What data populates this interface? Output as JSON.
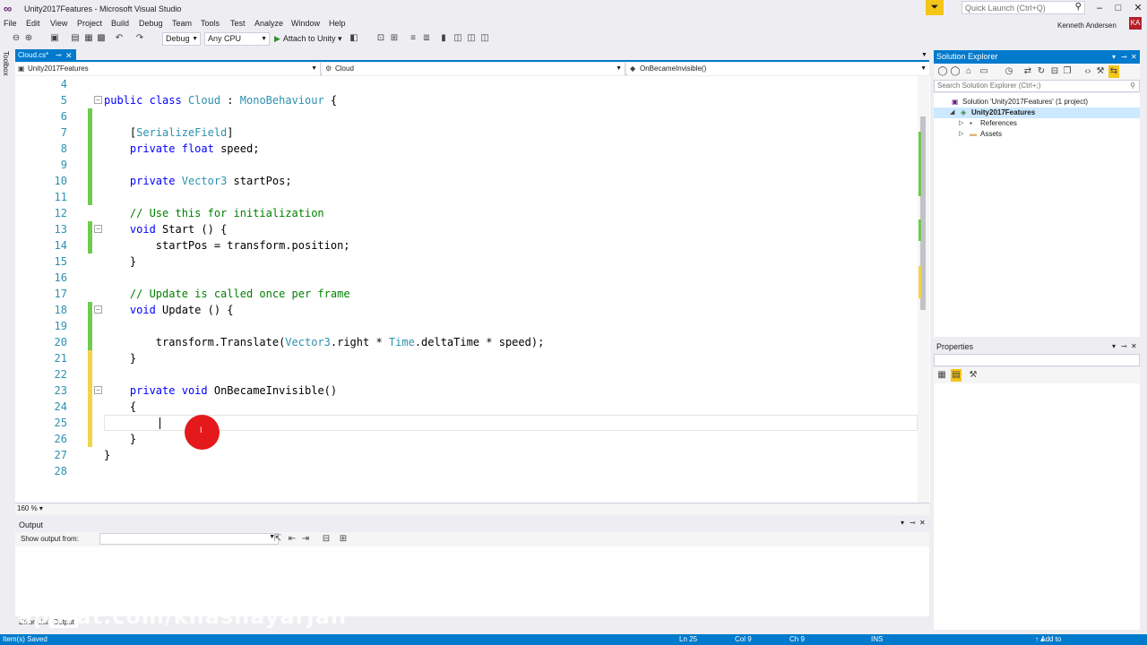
{
  "window": {
    "title": "Unity2017Features - Microsoft Visual Studio",
    "quick_launch_placeholder": "Quick Launch (Ctrl+Q)",
    "account": "Kenneth Andersen",
    "avatar_initials": "KA"
  },
  "menu": [
    "File",
    "Edit",
    "View",
    "Project",
    "Build",
    "Debug",
    "Team",
    "Tools",
    "Test",
    "Analyze",
    "Window",
    "Help"
  ],
  "toolbar": {
    "config": "Debug",
    "platform": "Any CPU",
    "attach_label": "Attach to Unity"
  },
  "toolbox_label": "Toolbox",
  "editor": {
    "tab_label": "Cloud.cs*",
    "nav_project": "Unity2017Features",
    "nav_class": "Cloud",
    "nav_member": "OnBecameInvisible()",
    "zoom": "160 %",
    "lines": [
      {
        "num": "4",
        "change": "none",
        "fold": false,
        "tokens": []
      },
      {
        "num": "5",
        "change": "none",
        "fold": true,
        "tokens": [
          {
            "t": "kw",
            "v": "public"
          },
          {
            "t": "pl",
            "v": " "
          },
          {
            "t": "kw",
            "v": "class"
          },
          {
            "t": "pl",
            "v": " "
          },
          {
            "t": "ty",
            "v": "Cloud"
          },
          {
            "t": "pl",
            "v": " : "
          },
          {
            "t": "ty",
            "v": "MonoBehaviour"
          },
          {
            "t": "pl",
            "v": " {"
          }
        ]
      },
      {
        "num": "6",
        "change": "saved",
        "fold": false,
        "tokens": []
      },
      {
        "num": "7",
        "change": "saved",
        "fold": false,
        "tokens": [
          {
            "t": "pl",
            "v": "    ["
          },
          {
            "t": "ty",
            "v": "SerializeField"
          },
          {
            "t": "pl",
            "v": "]"
          }
        ]
      },
      {
        "num": "8",
        "change": "saved",
        "fold": false,
        "tokens": [
          {
            "t": "pl",
            "v": "    "
          },
          {
            "t": "kw",
            "v": "private"
          },
          {
            "t": "pl",
            "v": " "
          },
          {
            "t": "kw",
            "v": "float"
          },
          {
            "t": "pl",
            "v": " speed;"
          }
        ]
      },
      {
        "num": "9",
        "change": "saved",
        "fold": false,
        "tokens": []
      },
      {
        "num": "10",
        "change": "saved",
        "fold": false,
        "tokens": [
          {
            "t": "pl",
            "v": "    "
          },
          {
            "t": "kw",
            "v": "private"
          },
          {
            "t": "pl",
            "v": " "
          },
          {
            "t": "ty",
            "v": "Vector3"
          },
          {
            "t": "pl",
            "v": " startPos;"
          }
        ]
      },
      {
        "num": "11",
        "change": "saved",
        "fold": false,
        "tokens": []
      },
      {
        "num": "12",
        "change": "none",
        "fold": false,
        "tokens": [
          {
            "t": "pl",
            "v": "    "
          },
          {
            "t": "cm",
            "v": "// Use this for initialization"
          }
        ]
      },
      {
        "num": "13",
        "change": "saved",
        "fold": true,
        "tokens": [
          {
            "t": "pl",
            "v": "    "
          },
          {
            "t": "kw",
            "v": "void"
          },
          {
            "t": "pl",
            "v": " Start () {"
          }
        ]
      },
      {
        "num": "14",
        "change": "saved",
        "fold": false,
        "tokens": [
          {
            "t": "pl",
            "v": "        startPos = transform.position;"
          }
        ]
      },
      {
        "num": "15",
        "change": "none",
        "fold": false,
        "tokens": [
          {
            "t": "pl",
            "v": "    }"
          }
        ]
      },
      {
        "num": "16",
        "change": "none",
        "fold": false,
        "tokens": []
      },
      {
        "num": "17",
        "change": "none",
        "fold": false,
        "tokens": [
          {
            "t": "pl",
            "v": "    "
          },
          {
            "t": "cm",
            "v": "// Update is called once per frame"
          }
        ]
      },
      {
        "num": "18",
        "change": "saved",
        "fold": true,
        "tokens": [
          {
            "t": "pl",
            "v": "    "
          },
          {
            "t": "kw",
            "v": "void"
          },
          {
            "t": "pl",
            "v": " Update () {"
          }
        ]
      },
      {
        "num": "19",
        "change": "saved",
        "fold": false,
        "tokens": []
      },
      {
        "num": "20",
        "change": "saved",
        "fold": false,
        "tokens": [
          {
            "t": "pl",
            "v": "        transform.Translate("
          },
          {
            "t": "ty",
            "v": "Vector3"
          },
          {
            "t": "pl",
            "v": ".right * "
          },
          {
            "t": "ty",
            "v": "Time"
          },
          {
            "t": "pl",
            "v": ".deltaTime * speed);"
          }
        ]
      },
      {
        "num": "21",
        "change": "unsaved",
        "fold": false,
        "tokens": [
          {
            "t": "pl",
            "v": "    }"
          }
        ]
      },
      {
        "num": "22",
        "change": "unsaved",
        "fold": false,
        "tokens": []
      },
      {
        "num": "23",
        "change": "unsaved",
        "fold": true,
        "tokens": [
          {
            "t": "pl",
            "v": "    "
          },
          {
            "t": "kw",
            "v": "private"
          },
          {
            "t": "pl",
            "v": " "
          },
          {
            "t": "kw",
            "v": "void"
          },
          {
            "t": "pl",
            "v": " OnBecameInvisible()"
          }
        ]
      },
      {
        "num": "24",
        "change": "unsaved",
        "fold": false,
        "tokens": [
          {
            "t": "pl",
            "v": "    {"
          }
        ]
      },
      {
        "num": "25",
        "change": "unsaved",
        "fold": false,
        "tokens": []
      },
      {
        "num": "26",
        "change": "unsaved",
        "fold": false,
        "tokens": [
          {
            "t": "pl",
            "v": "    }"
          }
        ]
      },
      {
        "num": "27",
        "change": "none",
        "fold": false,
        "tokens": [
          {
            "t": "pl",
            "v": "}"
          }
        ]
      },
      {
        "num": "28",
        "change": "none",
        "fold": false,
        "tokens": []
      }
    ],
    "current_line_index": 21
  },
  "output": {
    "title": "Output",
    "show_from_label": "Show output from:",
    "tabs": [
      "Error List",
      "Output"
    ],
    "active_tab": "Output"
  },
  "watermark": "aparat.com/khashayarjan",
  "solution_explorer": {
    "title": "Solution Explorer",
    "search_placeholder": "Search Solution Explorer (Ctrl+;)",
    "tree": [
      {
        "label": "Solution 'Unity2017Features' (1 project)",
        "depth": 0,
        "icon": "solution-icon",
        "expander": "",
        "selected": false
      },
      {
        "label": "Unity2017Features",
        "depth": 1,
        "icon": "project-icon",
        "expander": "◢",
        "selected": true
      },
      {
        "label": "References",
        "depth": 2,
        "icon": "references-icon",
        "expander": "▷",
        "selected": false
      },
      {
        "label": "Assets",
        "depth": 2,
        "icon": "folder-icon",
        "expander": "▷",
        "selected": false
      }
    ]
  },
  "properties": {
    "title": "Properties"
  },
  "status": {
    "message": "Item(s) Saved",
    "ln": "Ln 25",
    "col": "Col 9",
    "ch": "Ch 9",
    "mode": "INS",
    "source_control": "Add to Source Control"
  },
  "colors": {
    "accent": "#007acc",
    "change_saved": "#6fcb4f",
    "change_unsaved": "#f1d44a",
    "keyword": "#0000ff",
    "type": "#2b91af",
    "comment": "#008000",
    "click_indicator": "#e3191b"
  }
}
